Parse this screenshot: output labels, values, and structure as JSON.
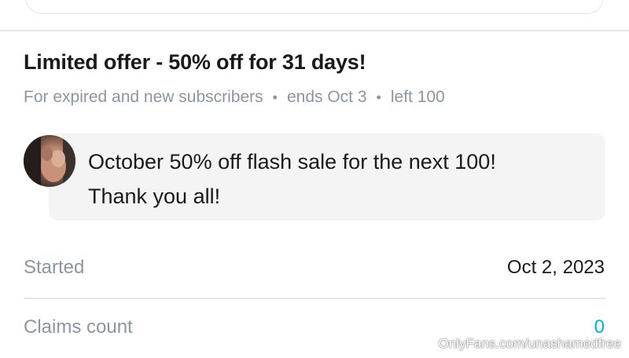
{
  "offer": {
    "title": "Limited offer - 50% off for 31 days!",
    "audience": "For expired and new subscribers",
    "ends": "ends Oct 3",
    "left": "left 100",
    "separator": "•"
  },
  "message": {
    "line1": "October 50% off flash sale for the next 100!",
    "line2": "Thank you all!"
  },
  "details": {
    "started_label": "Started",
    "started_value": "Oct 2, 2023",
    "claims_label": "Claims count",
    "claims_value": "0"
  },
  "watermark": "OnlyFans.com/unashamedfree",
  "colors": {
    "accent": "#00aff0",
    "muted_text": "#8a96a3",
    "bubble_bg": "#f4f4f5"
  }
}
